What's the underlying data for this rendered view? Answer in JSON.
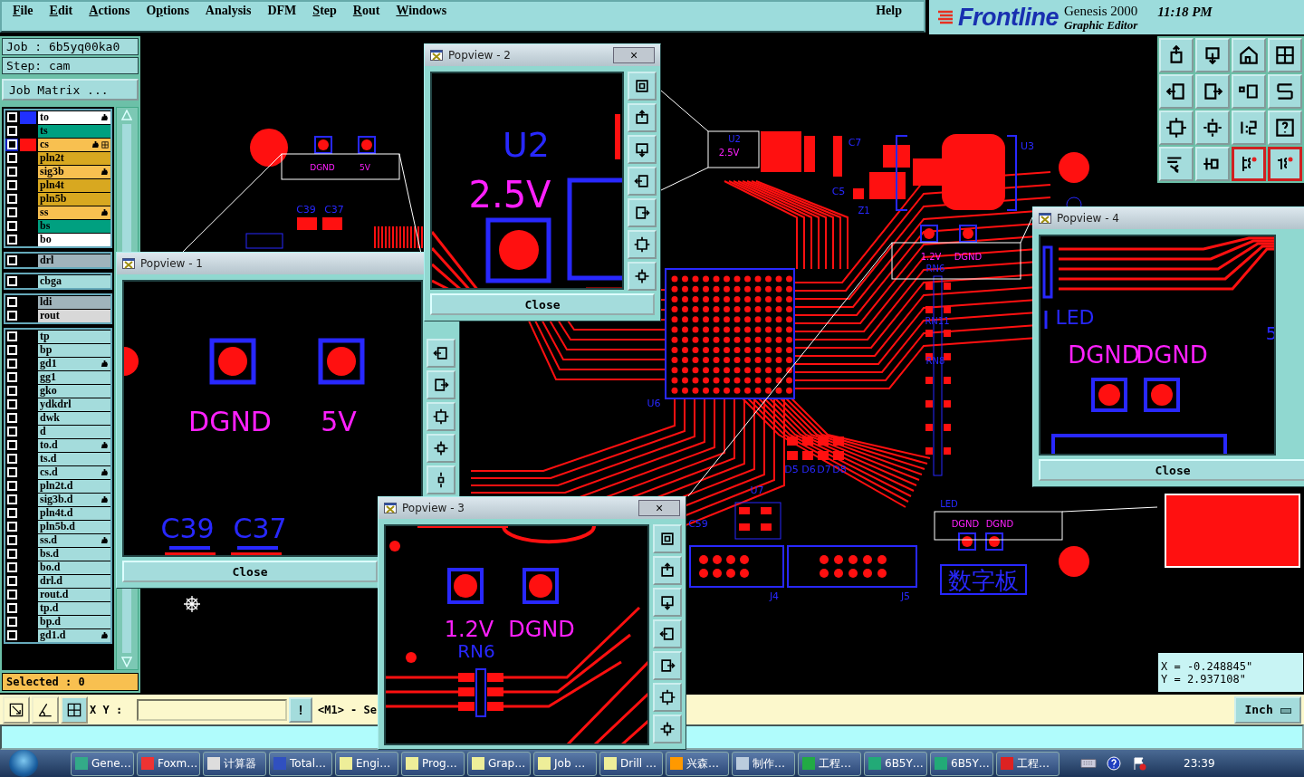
{
  "menu": [
    {
      "parts": [
        {
          "text": "F",
          "underline": true
        },
        {
          "text": "ile",
          "underline": false
        }
      ]
    },
    {
      "parts": [
        {
          "text": "E",
          "underline": true
        },
        {
          "text": "dit",
          "underline": false
        }
      ]
    },
    {
      "parts": [
        {
          "text": "A",
          "underline": true
        },
        {
          "text": "ctions",
          "underline": false
        }
      ]
    },
    {
      "parts": [
        {
          "text": "O",
          "underline": false
        },
        {
          "text": "p",
          "underline": true
        },
        {
          "text": "tions",
          "underline": false
        }
      ]
    },
    {
      "parts": [
        {
          "text": "Analysis",
          "underline": false
        }
      ]
    },
    {
      "parts": [
        {
          "text": "DFM",
          "underline": false
        }
      ]
    },
    {
      "parts": [
        {
          "text": "S",
          "underline": true
        },
        {
          "text": "tep",
          "underline": false
        }
      ]
    },
    {
      "parts": [
        {
          "text": "R",
          "underline": true
        },
        {
          "text": "out",
          "underline": false
        }
      ]
    },
    {
      "parts": [
        {
          "text": "W",
          "underline": true
        },
        {
          "text": "indows",
          "underline": false
        }
      ]
    }
  ],
  "help": "Help",
  "logo": {
    "brand": "Frontline",
    "product": "Genesis 2000",
    "subtitle": "Graphic Editor",
    "time": "11:18  PM"
  },
  "job": {
    "job": "Job  :  6b5yq00ka0",
    "step": "Step:  cam",
    "matrix_button": "Job Matrix ..."
  },
  "layer_groups": [
    {
      "layers": [
        {
          "name": "to",
          "kind": "silk",
          "swatch": {
            "color": "#2030ff"
          },
          "checked": false,
          "affected": true,
          "work": false
        },
        {
          "name": "ts",
          "kind": "mask",
          "checked": false,
          "affected": false,
          "work": false
        },
        {
          "name": "cs",
          "kind": "signal",
          "swatch": {
            "color": "#ff1010"
          },
          "checked": false,
          "affected": true,
          "work": true
        },
        {
          "name": "pln2t",
          "kind": "plane",
          "checked": false,
          "affected": false,
          "work": false
        },
        {
          "name": "sig3b",
          "kind": "signal",
          "checked": false,
          "affected": true,
          "work": false
        },
        {
          "name": "pln4t",
          "kind": "plane",
          "checked": false,
          "affected": false,
          "work": false
        },
        {
          "name": "pln5b",
          "kind": "plane",
          "checked": false,
          "affected": false,
          "work": false
        },
        {
          "name": "ss",
          "kind": "signal",
          "checked": false,
          "affected": true,
          "work": false
        },
        {
          "name": "bs",
          "kind": "mask",
          "checked": false,
          "affected": false,
          "work": false
        },
        {
          "name": "bo",
          "kind": "silk",
          "checked": false,
          "affected": false,
          "work": false
        }
      ]
    },
    {
      "layers": [
        {
          "name": "drl",
          "kind": "drill",
          "checked": false,
          "affected": false,
          "work": false
        }
      ]
    },
    {
      "layers": [
        {
          "name": "cbga",
          "kind": "misc",
          "checked": false,
          "affected": false,
          "work": false
        }
      ]
    },
    {
      "layers": [
        {
          "name": "ldi",
          "kind": "drill",
          "checked": false,
          "affected": false,
          "work": false
        },
        {
          "name": "rout",
          "kind": "rout",
          "checked": false,
          "affected": false,
          "work": false
        }
      ]
    },
    {
      "layers": [
        {
          "name": "tp",
          "kind": "misc",
          "checked": false,
          "affected": false,
          "work": false
        },
        {
          "name": "bp",
          "kind": "misc",
          "checked": false,
          "affected": false,
          "work": false
        },
        {
          "name": "gd1",
          "kind": "misc",
          "checked": false,
          "affected": true,
          "work": false
        },
        {
          "name": "gg1",
          "kind": "misc",
          "checked": false,
          "affected": false,
          "work": false
        },
        {
          "name": "gko",
          "kind": "misc",
          "checked": false,
          "affected": false,
          "work": false
        },
        {
          "name": "ydkdrl",
          "kind": "misc",
          "checked": false,
          "affected": false,
          "work": false
        },
        {
          "name": "dwk",
          "kind": "misc",
          "checked": false,
          "affected": false,
          "work": false
        },
        {
          "name": "d",
          "kind": "misc",
          "checked": false,
          "affected": false,
          "work": false
        },
        {
          "name": "to.d",
          "kind": "misc",
          "checked": false,
          "affected": true,
          "work": false
        },
        {
          "name": "ts.d",
          "kind": "misc",
          "checked": false,
          "affected": false,
          "work": false
        },
        {
          "name": "cs.d",
          "kind": "misc",
          "checked": false,
          "affected": true,
          "work": false
        },
        {
          "name": "pln2t.d",
          "kind": "misc",
          "checked": false,
          "affected": false,
          "work": false
        },
        {
          "name": "sig3b.d",
          "kind": "misc",
          "checked": false,
          "affected": true,
          "work": false
        },
        {
          "name": "pln4t.d",
          "kind": "misc",
          "checked": false,
          "affected": false,
          "work": false
        },
        {
          "name": "pln5b.d",
          "kind": "misc",
          "checked": false,
          "affected": false,
          "work": false
        },
        {
          "name": "ss.d",
          "kind": "misc",
          "checked": false,
          "affected": true,
          "work": false
        },
        {
          "name": "bs.d",
          "kind": "misc",
          "checked": false,
          "affected": false,
          "work": false
        },
        {
          "name": "bo.d",
          "kind": "misc",
          "checked": false,
          "affected": false,
          "work": false
        },
        {
          "name": "drl.d",
          "kind": "misc",
          "checked": false,
          "affected": false,
          "work": false
        },
        {
          "name": "rout.d",
          "kind": "misc",
          "checked": false,
          "affected": false,
          "work": false
        },
        {
          "name": "tp.d",
          "kind": "misc",
          "checked": false,
          "affected": false,
          "work": false
        },
        {
          "name": "bp.d",
          "kind": "misc",
          "checked": false,
          "affected": false,
          "work": false
        },
        {
          "name": "gd1.d",
          "kind": "misc",
          "checked": false,
          "affected": true,
          "work": false
        }
      ]
    }
  ],
  "selected_count": "Selected : 0",
  "canvas_labels": [
    {
      "text": "DGND",
      "kind": "net"
    },
    {
      "text": "5V",
      "kind": "net"
    },
    {
      "text": "C39",
      "kind": "ref"
    },
    {
      "text": "C37",
      "kind": "ref"
    },
    {
      "text": "U2",
      "kind": "ref"
    },
    {
      "text": "2.5V",
      "kind": "net"
    },
    {
      "text": "C7",
      "kind": "ref"
    },
    {
      "text": "U3",
      "kind": "ref"
    },
    {
      "text": "C5",
      "kind": "ref"
    },
    {
      "text": "Z1",
      "kind": "ref"
    },
    {
      "text": "1.2V",
      "kind": "net"
    },
    {
      "text": "DGND",
      "kind": "net"
    },
    {
      "text": "RN6",
      "kind": "ref"
    },
    {
      "text": "RN11",
      "kind": "ref"
    },
    {
      "text": "RN8",
      "kind": "ref"
    },
    {
      "text": "U6",
      "kind": "ref"
    },
    {
      "text": "D5",
      "kind": "ref"
    },
    {
      "text": "D6",
      "kind": "ref"
    },
    {
      "text": "D7",
      "kind": "ref"
    },
    {
      "text": "D8",
      "kind": "ref"
    },
    {
      "text": "U7",
      "kind": "ref"
    },
    {
      "text": "LED",
      "kind": "ref"
    },
    {
      "text": "C59",
      "kind": "ref"
    },
    {
      "text": "DGND",
      "kind": "net"
    },
    {
      "text": "DGND",
      "kind": "net"
    },
    {
      "text": "J4",
      "kind": "ref"
    },
    {
      "text": "J5",
      "kind": "ref"
    },
    {
      "text": "数字板",
      "kind": "ref"
    }
  ],
  "popviews": [
    {
      "title": "Popview - 1",
      "close_label": "Close",
      "labels": [
        {
          "text": "DGND",
          "kind": "net"
        },
        {
          "text": "5V",
          "kind": "net"
        },
        {
          "text": "C39",
          "kind": "ref"
        },
        {
          "text": "C37",
          "kind": "ref"
        }
      ]
    },
    {
      "title": "Popview - 2",
      "close_glyph": "×",
      "close_label": "Close",
      "labels": [
        {
          "text": "U2",
          "kind": "ref"
        },
        {
          "text": "2.5V",
          "kind": "net"
        }
      ]
    },
    {
      "title": "Popview - 3",
      "close_glyph": "×",
      "labels": [
        {
          "text": "1.2V",
          "kind": "net"
        },
        {
          "text": "DGND",
          "kind": "net"
        },
        {
          "text": "RN6",
          "kind": "ref"
        }
      ]
    },
    {
      "title": "Popview - 4",
      "close_label": "Close",
      "labels": [
        {
          "text": "LED",
          "kind": "ref"
        },
        {
          "text": "5",
          "kind": "ref"
        },
        {
          "text": "DGND",
          "kind": "net"
        },
        {
          "text": "DGND",
          "kind": "net"
        }
      ]
    }
  ],
  "coordinates": {
    "x": "X = -0.248845\"",
    "y": "Y = 2.937108\""
  },
  "command": {
    "xy_label": "X Y :",
    "bang": "!",
    "prompt": "<M1> - Se",
    "units": "Inch"
  },
  "taskbar": {
    "items": [
      {
        "label": "Gene…"
      },
      {
        "label": "Foxm…"
      },
      {
        "label": "计算器"
      },
      {
        "label": "Total…"
      },
      {
        "label": "Engi…"
      },
      {
        "label": "Prog…"
      },
      {
        "label": "Grap…"
      },
      {
        "label": "Job …"
      },
      {
        "label": "Drill …"
      },
      {
        "label": "兴森…"
      },
      {
        "label": "制作…"
      },
      {
        "label": "工程…"
      },
      {
        "label": "6B5Y…"
      },
      {
        "label": "6B5Y…"
      },
      {
        "label": "工程…"
      }
    ],
    "clock": "23:39"
  }
}
